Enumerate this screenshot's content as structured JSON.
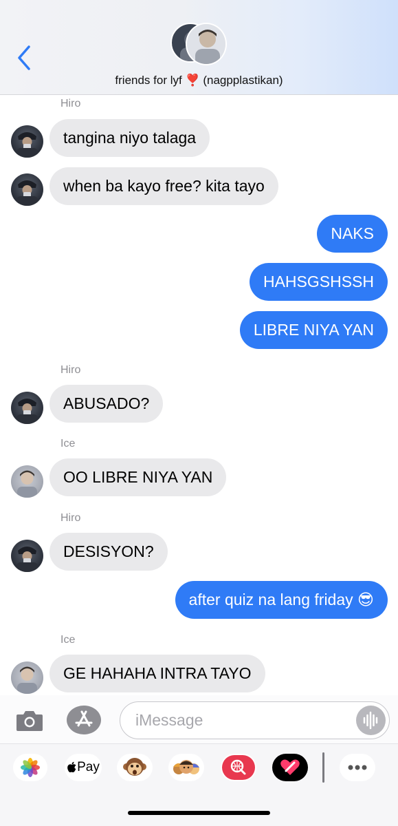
{
  "header": {
    "title": "friends for lyf ❣️  (nagpplastikan)"
  },
  "messages": [
    {
      "sender": "Hiro",
      "text": "tangina niyo talaga"
    },
    {
      "text": "when ba kayo free? kita tayo"
    },
    {
      "text": "NAKS"
    },
    {
      "text": "HAHSGSHSSH"
    },
    {
      "text": "LIBRE NIYA YAN"
    },
    {
      "sender": "Hiro",
      "text": "ABUSADO?"
    },
    {
      "sender": "Ice",
      "text": "OO LIBRE NIYA YAN"
    },
    {
      "sender": "Hiro",
      "text": "DESISYON?"
    },
    {
      "text": "after quiz na lang friday 😎"
    },
    {
      "sender": "Ice",
      "text": "GE HAHAHA INTRA TAYO"
    }
  ],
  "composer": {
    "placeholder": "iMessage"
  },
  "drawer": {
    "apple_pay_label": "Pay"
  },
  "colors": {
    "outgoing_bubble": "#2f7bf6",
    "incoming_bubble": "#e9e9eb",
    "accent": "#2f7bf6"
  },
  "icons": [
    "back-chevron-icon",
    "camera-icon",
    "app-store-icon",
    "audio-waveform-icon",
    "photos-icon",
    "apple-pay-icon",
    "animoji-monkey-icon",
    "memoji-icon",
    "image-search-icon",
    "digital-touch-icon",
    "more-icon"
  ]
}
